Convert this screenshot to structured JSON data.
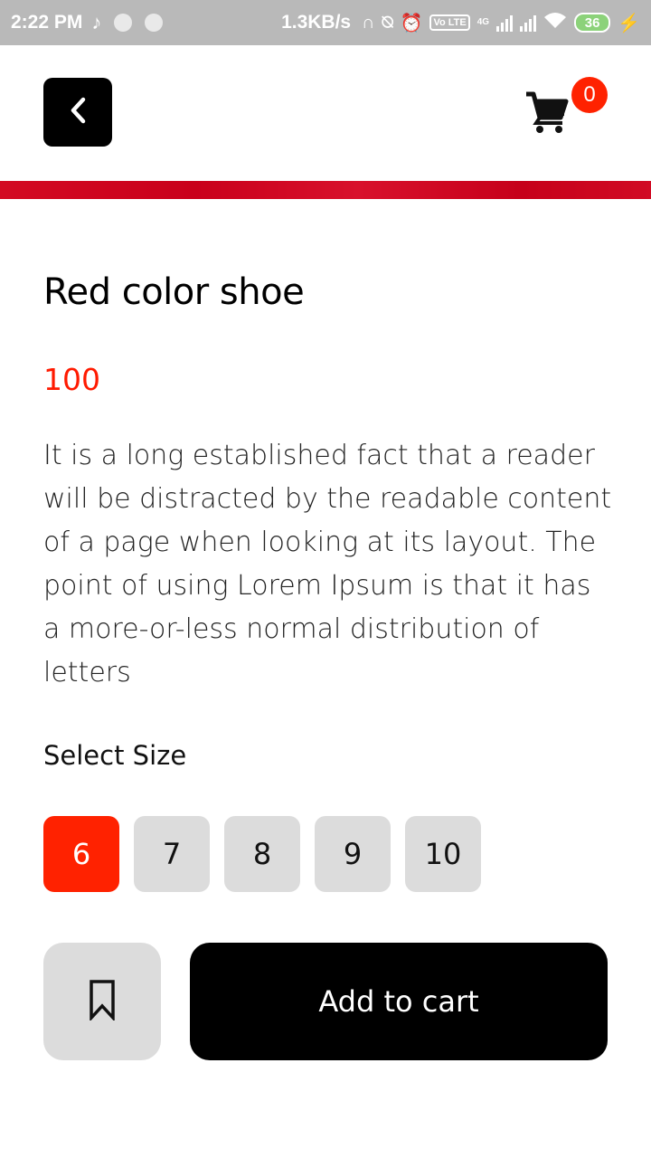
{
  "status_bar": {
    "time": "2:22 PM",
    "network_speed": "1.3KB/s",
    "volte_label": "Vo LTE",
    "network_type": "4G",
    "battery_level": "36"
  },
  "header": {
    "cart_count": "0"
  },
  "product": {
    "title": "Red color shoe",
    "price": "100",
    "description": "It is a long established fact that a reader will be distracted by the readable content of a page when looking at its layout. The point of using Lorem Ipsum is that it has a more-or-less normal distribution of letters"
  },
  "size_selector": {
    "label": "Select Size",
    "options": [
      "6",
      "7",
      "8",
      "9",
      "10"
    ],
    "selected": "6"
  },
  "actions": {
    "add_to_cart_label": "Add to cart"
  },
  "colors": {
    "accent_red": "#ff2200",
    "banner_red": "#d30a22",
    "chip_gray": "#dcdcdc",
    "button_black": "#000000"
  }
}
